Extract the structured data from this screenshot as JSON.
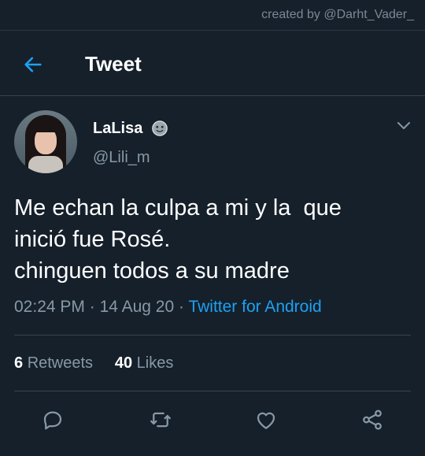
{
  "credit": "created by @Darht_Vader_",
  "header": {
    "title": "Tweet"
  },
  "tweet": {
    "name": "LaLisa",
    "handle": "@Lili_m",
    "text": "Me echan la culpa a mi y la  que\ninició fue Rosé.\nchinguen todos a su madre",
    "time": "02:24 PM",
    "date": "14 Aug 20",
    "source": "Twitter for Android"
  },
  "stats": {
    "retweets_count": "6",
    "retweets_label": "Retweets",
    "likes_count": "40",
    "likes_label": "Likes"
  },
  "icons": {
    "back": "arrow-left-icon",
    "emoji": "smiling-face-icon",
    "more": "chevron-down-icon",
    "reply": "reply-icon",
    "retweet": "retweet-icon",
    "like": "heart-icon",
    "share": "share-icon"
  },
  "colors": {
    "background": "#15202b",
    "accent": "#1da1f2",
    "secondary_text": "#8899a6",
    "divider": "#38444d"
  }
}
